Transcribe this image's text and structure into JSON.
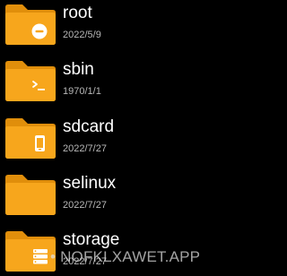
{
  "colors": {
    "folder_body": "#F7A61C",
    "folder_tab": "#E08E0B",
    "folder_badge": "#FFFFFF",
    "background": "#000000",
    "name_text": "#FFFFFF",
    "date_text": "#B8B8B8"
  },
  "files": [
    {
      "name": "root",
      "date": "2022/5/9",
      "icon": "folder-minus-icon"
    },
    {
      "name": "sbin",
      "date": "1970/1/1",
      "icon": "folder-terminal-icon"
    },
    {
      "name": "sdcard",
      "date": "2022/7/27",
      "icon": "folder-phone-icon"
    },
    {
      "name": "selinux",
      "date": "2022/7/27",
      "icon": "folder-icon"
    },
    {
      "name": "storage",
      "date": "2022/7/27",
      "icon": "folder-storage-icon"
    }
  ],
  "watermark": "• NOFKLXAWET.APP"
}
